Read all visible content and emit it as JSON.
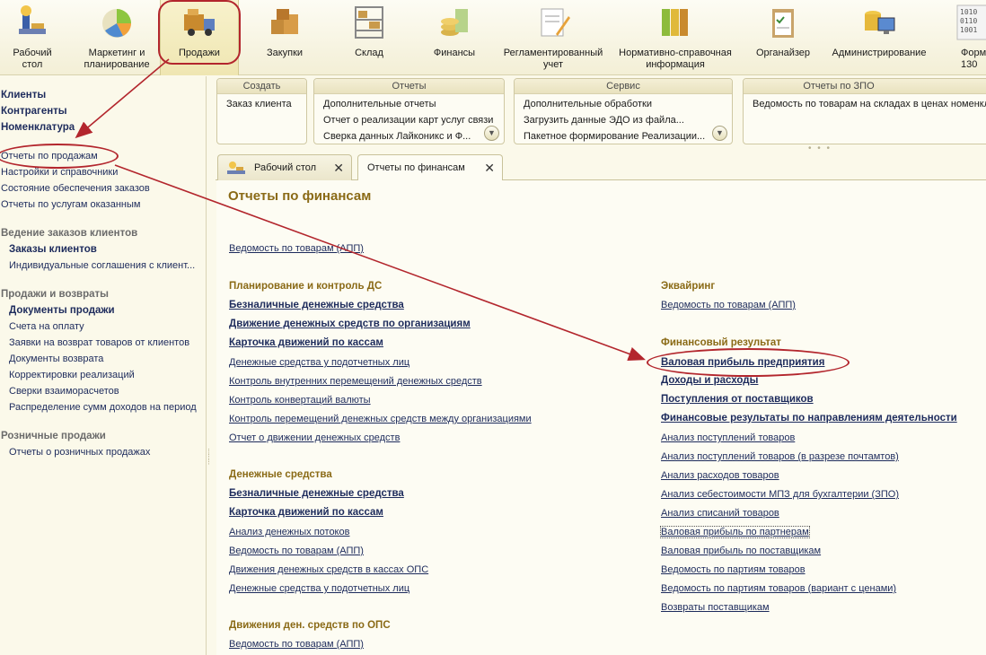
{
  "sections": [
    {
      "label": "Рабочий\nстол",
      "icon": "desktop-icon"
    },
    {
      "label": "Маркетинг и\nпланирование",
      "icon": "pie-chart-icon"
    },
    {
      "label": "Продажи",
      "icon": "delivery-truck-icon"
    },
    {
      "label": "Закупки",
      "icon": "boxes-icon"
    },
    {
      "label": "Склад",
      "icon": "warehouse-shelves-icon"
    },
    {
      "label": "Финансы",
      "icon": "coins-icon"
    },
    {
      "label": "Регламентированный\nучет",
      "icon": "document-pen-icon"
    },
    {
      "label": "Нормативно-справочная\nинформация",
      "icon": "binders-icon"
    },
    {
      "label": "Органайзер",
      "icon": "clipboard-icon"
    },
    {
      "label": "Администрирование",
      "icon": "computer-database-icon"
    },
    {
      "label": "Форм\n130",
      "icon": "binary-code-icon"
    }
  ],
  "left_panel": {
    "top_links": [
      "Клиенты",
      "Контрагенты",
      "Номенклатура"
    ],
    "plain_links": [
      "Отчеты по продажам",
      "Настройки и справочники",
      "Состояние обеспечения заказов",
      "Отчеты по услугам оказанным"
    ],
    "group1": {
      "title": "Ведение заказов клиентов",
      "items": [
        "Заказы клиентов",
        "Индивидуальные соглашения с клиент..."
      ]
    },
    "group2": {
      "title": "Продажи и возвраты",
      "items": [
        "Документы продажи",
        "Счета на оплату",
        "Заявки на возврат товаров от клиентов",
        "Документы возврата",
        "Корректировки реализаций",
        "Сверки взаиморасчетов",
        "Распределение сумм доходов на период"
      ]
    },
    "group3": {
      "title": "Розничные продажи",
      "items": [
        "Отчеты о розничных продажах"
      ]
    }
  },
  "commands": {
    "create": {
      "title": "Создать",
      "items": [
        "Заказ клиента"
      ]
    },
    "reports": {
      "title": "Отчеты",
      "items": [
        "Дополнительные отчеты",
        "Отчет о реализации карт услуг связи",
        "Сверка данных Лайконикс и Ф..."
      ]
    },
    "service": {
      "title": "Сервис",
      "items": [
        "Дополнительные обработки",
        "Загрузить данные ЭДО из файла...",
        "Пакетное формирование Реализации..."
      ]
    },
    "zpo": {
      "title": "Отчеты по ЗПО",
      "items": [
        "Ведомость по товарам на складах в ценах номенкл"
      ]
    }
  },
  "tabs": [
    {
      "label": "Рабочий стол"
    },
    {
      "label": "Отчеты по финансам"
    }
  ],
  "page": {
    "title": "Отчеты по финансам",
    "top_link": "Ведомость по товарам (АПП)",
    "left_col": {
      "planning": {
        "title": "Планирование и контроль ДС",
        "items": [
          "Безналичные денежные средства",
          "Движение денежных средств по организациям",
          "Карточка движений по кассам",
          "Денежные средства у подотчетных лиц",
          "Контроль внутренних перемещений денежных средств",
          "Контроль конвертаций валюты",
          "Контроль перемещений денежных средств между организациями",
          "Отчет о движении денежных средств"
        ]
      },
      "money": {
        "title": "Денежные средства",
        "items": [
          "Безналичные денежные средства",
          "Карточка движений по кассам",
          "Анализ денежных потоков",
          "Ведомость по товарам (АПП)",
          "Движения денежных средств в кассах ОПС",
          "Денежные средства у подотчетных лиц"
        ]
      },
      "ops": {
        "title": "Движения ден. средств по ОПС",
        "items": [
          "Ведомость по товарам (АПП)"
        ]
      }
    },
    "right_col": {
      "acquiring": {
        "title": "Эквайринг",
        "items": [
          "Ведомость по товарам (АПП)"
        ]
      },
      "financial": {
        "title": "Финансовый результат",
        "items": [
          "Валовая прибыль предприятия",
          "Доходы и расходы",
          "Поступления от поставщиков",
          "Финансовые результаты по направлениям деятельности",
          "Анализ поступлений товаров",
          "Анализ поступлений товаров (в разрезе почтамтов)",
          "Анализ расходов товаров",
          "Анализ себестоимости МПЗ для бухгалтерии (ЗПО)",
          "Анализ списаний товаров",
          "Валовая прибыль по партнерам",
          "Валовая прибыль по поставщикам",
          "Ведомость по партиям товаров",
          "Ведомость по партиям товаров (вариант с ценами)",
          "Возвраты поставщикам"
        ]
      }
    }
  },
  "colors": {
    "annotation": "#b3262d",
    "heading": "#8a6a16",
    "link": "#1d2b5c"
  }
}
